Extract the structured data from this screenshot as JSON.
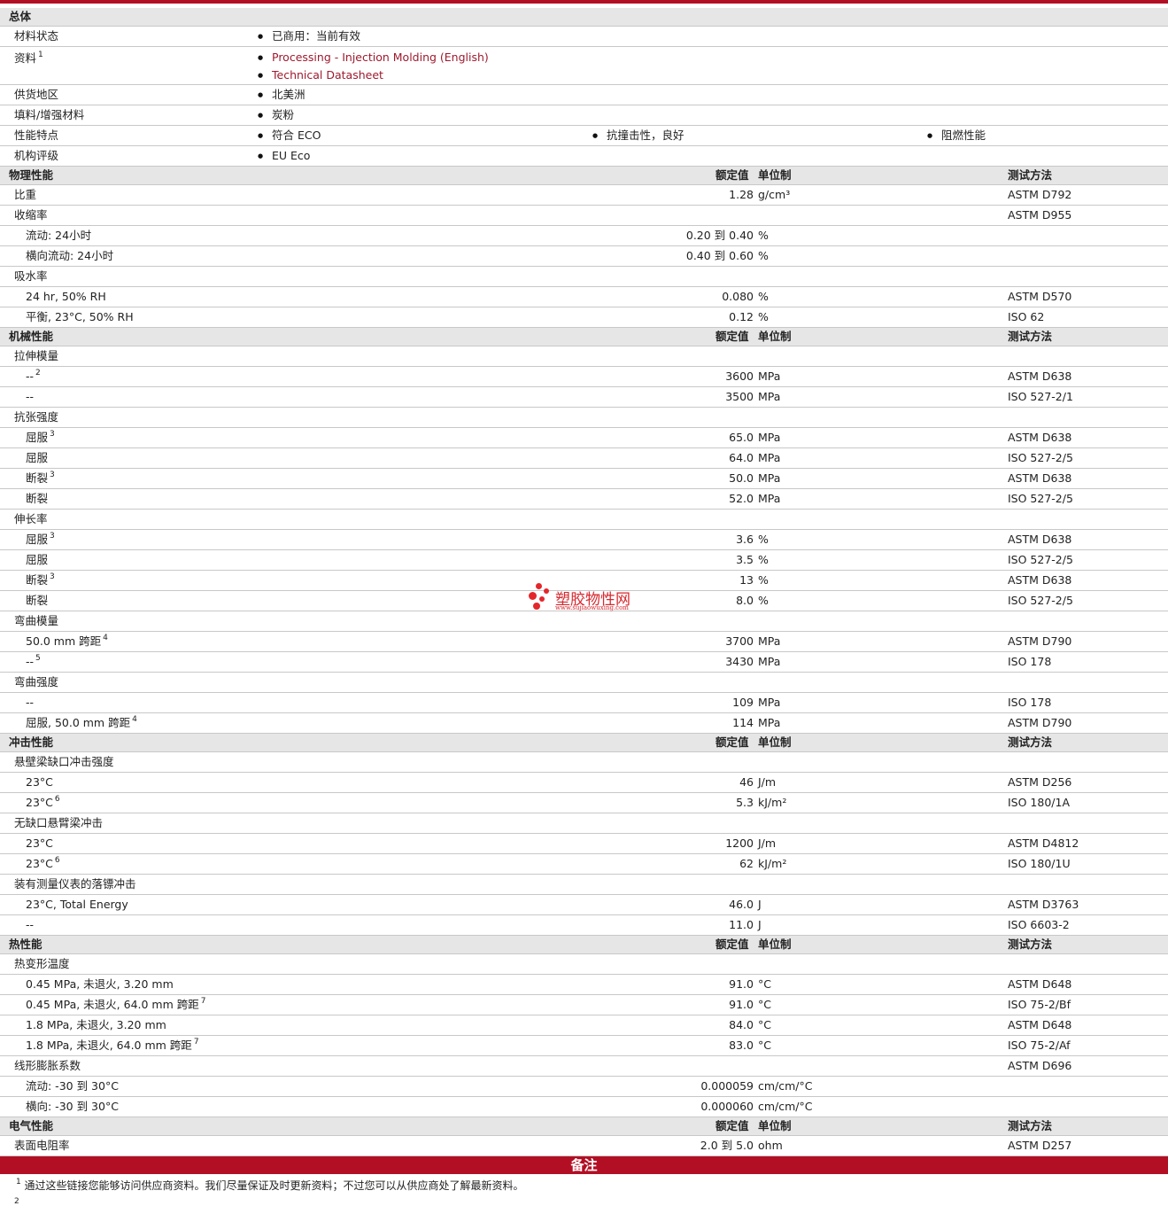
{
  "colors": {
    "accent": "#b30f24",
    "section_bg": "#e6e6e6",
    "link": "#9e1a2e"
  },
  "general": {
    "title": "总体",
    "rows": [
      {
        "label": "材料状态",
        "items": [
          "已商用：当前有效"
        ]
      },
      {
        "label": "资料",
        "sup": "1",
        "links": [
          "Processing - Injection Molding (English)",
          "Technical Datasheet"
        ]
      },
      {
        "label": "供货地区",
        "items": [
          "北美洲"
        ]
      },
      {
        "label": "填料/增强材料",
        "items": [
          "炭粉"
        ]
      },
      {
        "label": "性能特点",
        "items": [
          "符合 ECO",
          "抗撞击性，良好",
          "阻燃性能"
        ]
      },
      {
        "label": "机构评级",
        "items": [
          "EU Eco"
        ]
      }
    ]
  },
  "headers": {
    "nominal": "额定值",
    "unit": "单位制",
    "method": "测试方法"
  },
  "sections": [
    {
      "title": "物理性能",
      "rows": [
        {
          "label": "比重",
          "value": "1.28",
          "unit": "g/cm³",
          "method": "ASTM D792"
        },
        {
          "label": "收缩率",
          "method": "ASTM D955"
        },
        {
          "label": "流动: 24小时",
          "ind": true,
          "value": "0.20 到  0.40",
          "unit": "%"
        },
        {
          "label": "横向流动: 24小时",
          "ind": true,
          "value": "0.40 到  0.60",
          "unit": "%"
        },
        {
          "label": "吸水率"
        },
        {
          "label": "24 hr, 50% RH",
          "ind": true,
          "value": "0.080",
          "unit": "%",
          "method": "ASTM D570"
        },
        {
          "label": "平衡, 23°C, 50% RH",
          "ind": true,
          "value": "0.12",
          "unit": "%",
          "method": "ISO 62"
        }
      ]
    },
    {
      "title": "机械性能",
      "rows": [
        {
          "label": "拉伸模量"
        },
        {
          "label": "--",
          "sup": "2",
          "ind": true,
          "value": "3600",
          "unit": "MPa",
          "method": "ASTM D638"
        },
        {
          "label": "--",
          "ind": true,
          "value": "3500",
          "unit": "MPa",
          "method": "ISO 527-2/1"
        },
        {
          "label": "抗张强度"
        },
        {
          "label": "屈服",
          "sup": "3",
          "ind": true,
          "value": "65.0",
          "unit": "MPa",
          "method": "ASTM D638"
        },
        {
          "label": "屈服",
          "ind": true,
          "value": "64.0",
          "unit": "MPa",
          "method": "ISO 527-2/5"
        },
        {
          "label": "断裂",
          "sup": "3",
          "ind": true,
          "value": "50.0",
          "unit": "MPa",
          "method": "ASTM D638"
        },
        {
          "label": "断裂",
          "ind": true,
          "value": "52.0",
          "unit": "MPa",
          "method": "ISO 527-2/5"
        },
        {
          "label": "伸长率"
        },
        {
          "label": "屈服",
          "sup": "3",
          "ind": true,
          "value": "3.6",
          "unit": "%",
          "method": "ASTM D638"
        },
        {
          "label": "屈服",
          "ind": true,
          "value": "3.5",
          "unit": "%",
          "method": "ISO 527-2/5"
        },
        {
          "label": "断裂",
          "sup": "3",
          "ind": true,
          "value": "13",
          "unit": "%",
          "method": "ASTM D638"
        },
        {
          "label": "断裂",
          "ind": true,
          "value": "8.0",
          "unit": "%",
          "method": "ISO 527-2/5"
        },
        {
          "label": "弯曲模量"
        },
        {
          "label": "50.0 mm 跨距",
          "sup": "4",
          "ind": true,
          "value": "3700",
          "unit": "MPa",
          "method": "ASTM D790"
        },
        {
          "label": "--",
          "sup": "5",
          "ind": true,
          "value": "3430",
          "unit": "MPa",
          "method": "ISO 178"
        },
        {
          "label": "弯曲强度"
        },
        {
          "label": "--",
          "ind": true,
          "value": "109",
          "unit": "MPa",
          "method": "ISO 178"
        },
        {
          "label": "屈服, 50.0 mm 跨距",
          "sup": "4",
          "ind": true,
          "value": "114",
          "unit": "MPa",
          "method": "ASTM D790"
        }
      ]
    },
    {
      "title": "冲击性能",
      "rows": [
        {
          "label": "悬壁梁缺口冲击强度"
        },
        {
          "label": "23°C",
          "ind": true,
          "value": "46",
          "unit": "J/m",
          "method": "ASTM D256"
        },
        {
          "label": "23°C",
          "sup": "6",
          "ind": true,
          "value": "5.3",
          "unit": "kJ/m²",
          "method": "ISO 180/1A"
        },
        {
          "label": "无缺口悬臂梁冲击"
        },
        {
          "label": "23°C",
          "ind": true,
          "value": "1200",
          "unit": "J/m",
          "method": "ASTM D4812"
        },
        {
          "label": "23°C",
          "sup": "6",
          "ind": true,
          "value": "62",
          "unit": "kJ/m²",
          "method": "ISO 180/1U"
        },
        {
          "label": "装有测量仪表的落镖冲击"
        },
        {
          "label": "23°C, Total Energy",
          "ind": true,
          "value": "46.0",
          "unit": "J",
          "method": "ASTM D3763"
        },
        {
          "label": "--",
          "ind": true,
          "value": "11.0",
          "unit": "J",
          "method": "ISO 6603-2"
        }
      ]
    },
    {
      "title": "热性能",
      "rows": [
        {
          "label": "热变形温度"
        },
        {
          "label": "0.45 MPa, 未退火, 3.20 mm",
          "ind": true,
          "value": "91.0",
          "unit": "°C",
          "method": "ASTM D648"
        },
        {
          "label": "0.45 MPa, 未退火, 64.0 mm 跨距",
          "sup": "7",
          "ind": true,
          "value": "91.0",
          "unit": "°C",
          "method": "ISO 75-2/Bf"
        },
        {
          "label": "1.8 MPa, 未退火, 3.20 mm",
          "ind": true,
          "value": "84.0",
          "unit": "°C",
          "method": "ASTM D648"
        },
        {
          "label": "1.8 MPa, 未退火, 64.0 mm 跨距",
          "sup": "7",
          "ind": true,
          "value": "83.0",
          "unit": "°C",
          "method": "ISO 75-2/Af"
        },
        {
          "label": "线形膨胀系数",
          "method": "ASTM D696"
        },
        {
          "label": "流动: -30 到  30°C",
          "ind": true,
          "value": "0.000059",
          "unit": "cm/cm/°C"
        },
        {
          "label": "横向: -30 到  30°C",
          "ind": true,
          "value": "0.000060",
          "unit": "cm/cm/°C"
        }
      ]
    },
    {
      "title": "电气性能",
      "rows": [
        {
          "label": "表面电阻率",
          "value": "2.0 到  5.0",
          "unit": "ohm",
          "method": "ASTM D257"
        }
      ]
    }
  ],
  "notes": {
    "title": "备注",
    "items": [
      {
        "num": "1",
        "text": "通过这些链接您能够访问供应商资料。我们尽量保证及时更新资料；不过您可以从供应商处了解最新资料。"
      }
    ],
    "next_num": "2"
  },
  "watermark": {
    "title": "塑胶物性网",
    "url": "www.sujiaowuxing.com"
  }
}
